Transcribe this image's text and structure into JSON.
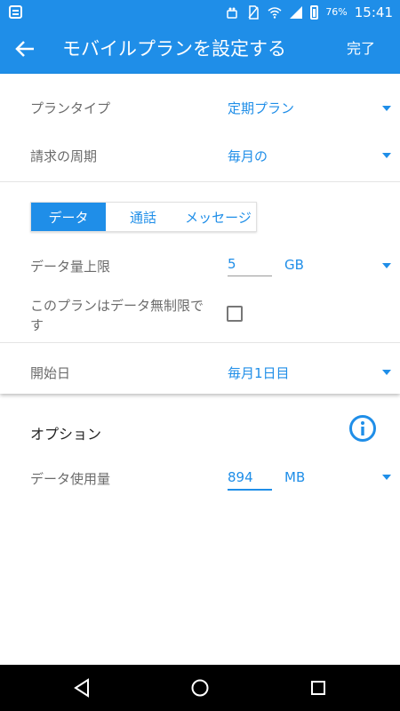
{
  "status_bar": {
    "battery": "76%",
    "time": "15:41"
  },
  "app_bar": {
    "title": "モバイルプランを設定する",
    "done_label": "完了"
  },
  "plan": {
    "plan_type_label": "プランタイプ",
    "plan_type_value": "定期プラン",
    "billing_cycle_label": "請求の周期",
    "billing_cycle_value": "毎月の"
  },
  "tabs": [
    {
      "label": "データ",
      "active": true
    },
    {
      "label": "通話",
      "active": false
    },
    {
      "label": "メッセージ",
      "active": false
    }
  ],
  "data_limit": {
    "label": "データ量上限",
    "value": "5",
    "unit": "GB"
  },
  "unlimited": {
    "label_line1": "このプランはデータ無制限で",
    "label_line2": "す",
    "checked": false
  },
  "start_date": {
    "label": "開始日",
    "value": "毎月1日目"
  },
  "options": {
    "title": "オプション",
    "data_usage_label": "データ使用量",
    "data_usage_value": "894",
    "data_usage_unit": "MB"
  },
  "colors": {
    "accent": "#1f8ee8"
  }
}
